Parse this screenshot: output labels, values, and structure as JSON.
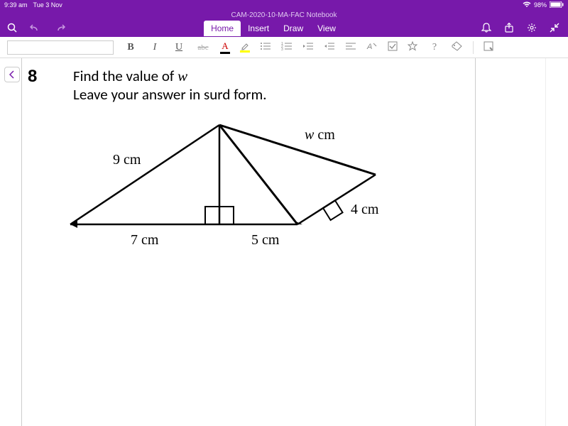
{
  "status": {
    "time": "9:39 am",
    "date": "Tue 3 Nov",
    "battery": "98%"
  },
  "doc_title": "CAM-2020-10-MA-FAC Notebook",
  "tabs": {
    "home": "Home",
    "insert": "Insert",
    "draw": "Draw",
    "view": "View"
  },
  "toolbar": {
    "bold": "B",
    "italic": "I",
    "underline": "U",
    "strike": "abc",
    "font_color_letter": "A",
    "help": "?"
  },
  "question": {
    "number": "8",
    "line1_a": "Find the value of ",
    "line1_var": "w",
    "line2": "Leave your answer in surd form."
  },
  "diagram": {
    "labels": {
      "left_hyp": "9 cm",
      "top_right": "w cm",
      "right_side": "4 cm",
      "base_left": "7 cm",
      "base_right": "5 cm"
    }
  }
}
